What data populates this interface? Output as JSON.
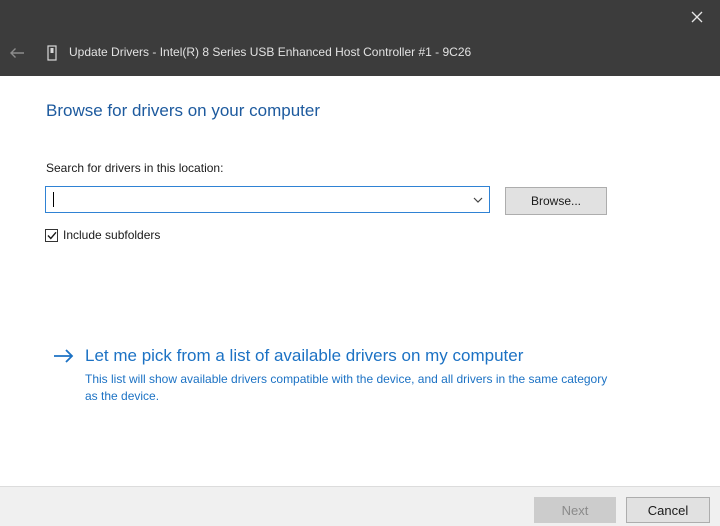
{
  "window": {
    "title": "Update Drivers - Intel(R) 8 Series USB Enhanced Host Controller #1 - 9C26"
  },
  "icons": {
    "close": "close-icon",
    "back": "back-arrow-icon",
    "device": "device-icon",
    "dropdown": "chevron-down-icon",
    "check": "checkmark-icon",
    "link_arrow": "right-arrow-icon"
  },
  "main": {
    "heading": "Browse for drivers on your computer",
    "search_label": "Search for drivers in this location:",
    "search_value": "",
    "browse_label": "Browse...",
    "include_subfolders_label": "Include subfolders",
    "include_subfolders_checked": true,
    "pick_link": "Let me pick from a list of available drivers on my computer",
    "pick_description": "This list will show available drivers compatible with the device, and all drivers in the same category as the device."
  },
  "footer": {
    "next_label": "Next",
    "cancel_label": "Cancel"
  },
  "colors": {
    "titlebar": "#3c3c3c",
    "heading": "#1d5a9e",
    "link": "#1c72c4",
    "focus_border": "#2f82d4"
  }
}
